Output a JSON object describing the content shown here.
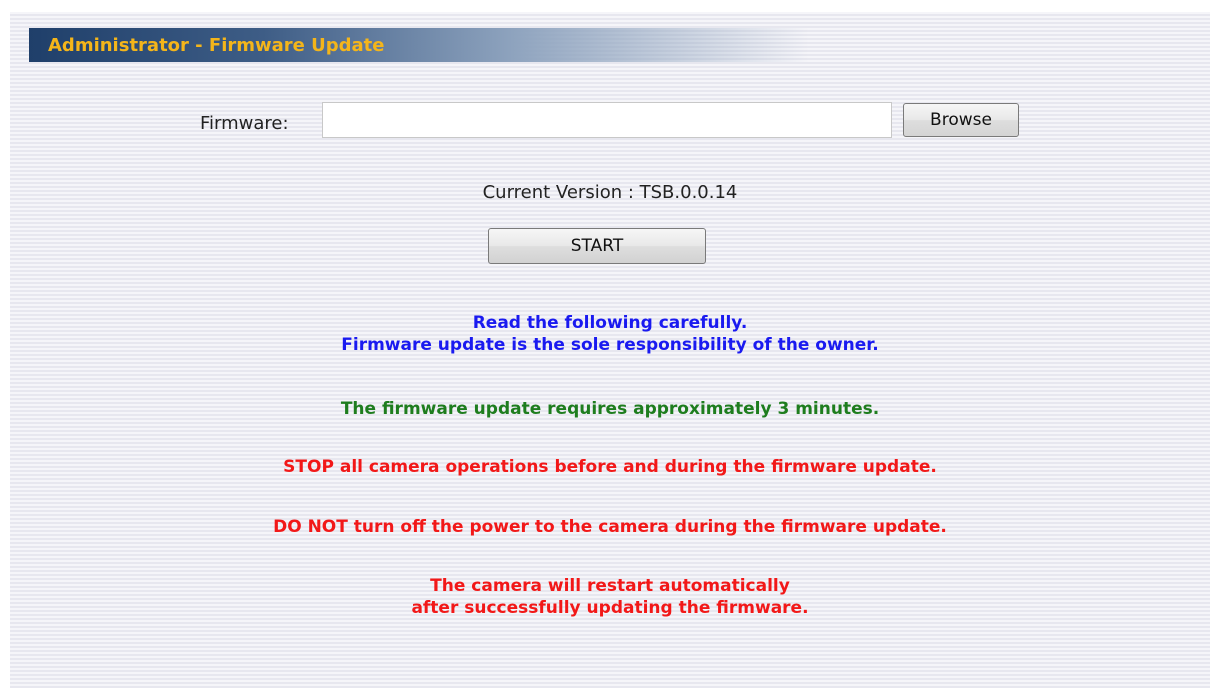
{
  "header": {
    "title": "Administrator - Firmware Update"
  },
  "form": {
    "firmware_label": "Firmware:",
    "firmware_value": "",
    "browse_label": "Browse",
    "version_label": "Current Version : TSB.0.0.14",
    "start_label": "START"
  },
  "notices": {
    "read_line1": "Read the following carefully.",
    "read_line2": "Firmware update is the sole responsibility of the owner.",
    "duration": "The firmware update requires approximately 3 minutes.",
    "stop_ops": "STOP all camera operations before and during the firmware update.",
    "no_power_off": "DO NOT turn off the power to the camera during the firmware update.",
    "restart_line1": "The camera will restart automatically",
    "restart_line2": "after successfully updating the firmware."
  },
  "colors": {
    "title_text": "#f4b51a",
    "title_bar": "#1f3f6a",
    "info_blue": "#1a1af0",
    "info_green": "#1e7d1e",
    "warning_red": "#f21818"
  }
}
